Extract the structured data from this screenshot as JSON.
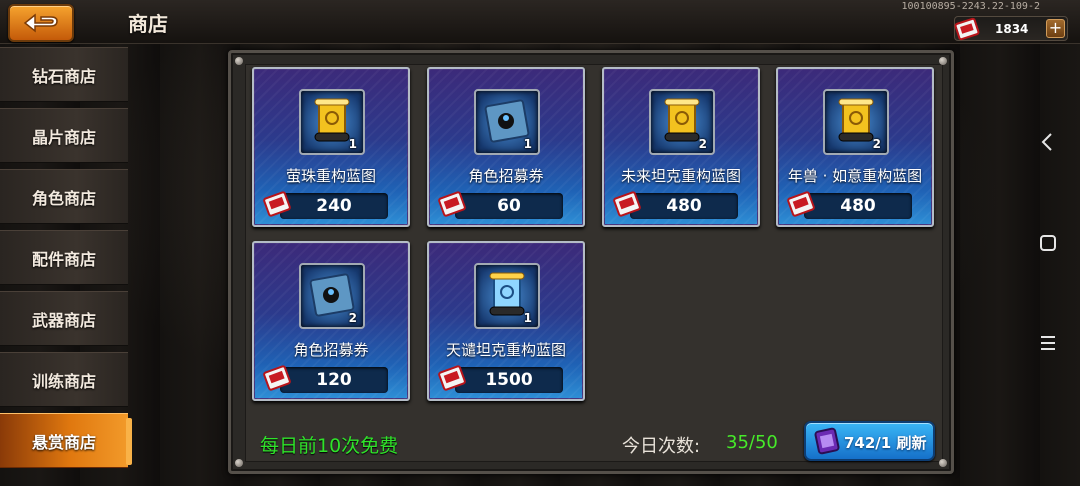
{
  "header": {
    "title": "商店",
    "id_text": "100100895-2243.22-109-2"
  },
  "currency": {
    "value": "1834",
    "plus_label": "+"
  },
  "sidebar": {
    "items": [
      {
        "label": "钻石商店",
        "active": false
      },
      {
        "label": "晶片商店",
        "active": false
      },
      {
        "label": "角色商店",
        "active": false
      },
      {
        "label": "配件商店",
        "active": false
      },
      {
        "label": "武器商店",
        "active": false
      },
      {
        "label": "训练商店",
        "active": false
      },
      {
        "label": "悬赏商店",
        "active": true
      }
    ]
  },
  "shop": {
    "items": [
      {
        "name": "萤珠重构蓝图",
        "qty": "1",
        "price": "240",
        "icon": "gold-blueprint-scroll-icon"
      },
      {
        "name": "角色招募券",
        "qty": "1",
        "price": "60",
        "icon": "recruit-ticket-icon"
      },
      {
        "name": "未来坦克重构蓝图",
        "qty": "2",
        "price": "480",
        "icon": "gold-blueprint-scroll-icon"
      },
      {
        "name": "年兽 · 如意重构蓝图",
        "qty": "2",
        "price": "480",
        "icon": "gold-blueprint-scroll-icon"
      },
      {
        "name": "角色招募券",
        "qty": "2",
        "price": "120",
        "icon": "recruit-ticket-icon"
      },
      {
        "name": "天谴坦克重构蓝图",
        "qty": "1",
        "price": "1500",
        "icon": "blue-blueprint-scroll-icon"
      }
    ]
  },
  "footer": {
    "free_text": "每日前10次免费",
    "count_label": "今日次数:",
    "count_value": "35/50",
    "refresh_label": "742/1 刷新"
  },
  "colors": {
    "accent_orange": "#e0780f",
    "free_green": "#2fe32a",
    "refresh_blue": "#1f8ae0"
  }
}
